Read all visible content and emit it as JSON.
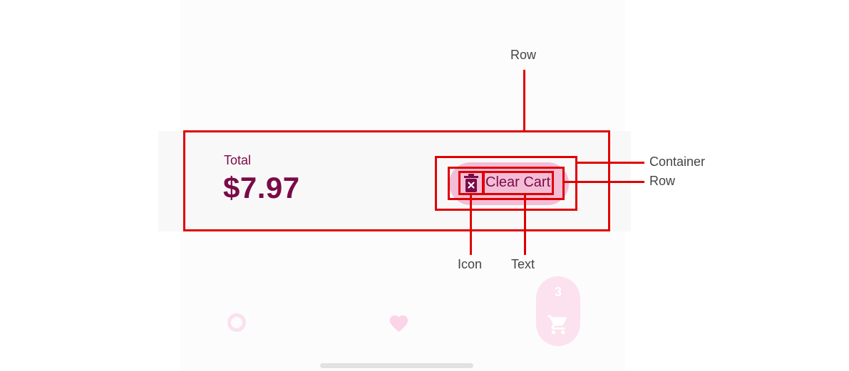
{
  "cart": {
    "total_label": "Total",
    "total_value": "$7.97",
    "clear_button_label": "Clear Cart",
    "clear_icon": "trash-x-icon"
  },
  "annotations": {
    "row_top": "Row",
    "container": "Container",
    "row_right": "Row",
    "icon": "Icon",
    "text": "Text"
  },
  "bottom_nav": {
    "cart_badge": "3",
    "icons": [
      "ring-icon",
      "heart-icon",
      "cart-icon"
    ]
  },
  "colors": {
    "brand": "#7a0a48",
    "button_bg": "#f4bdd6",
    "annotation": "#e00000",
    "nav_tint": "#fbe2ee"
  }
}
